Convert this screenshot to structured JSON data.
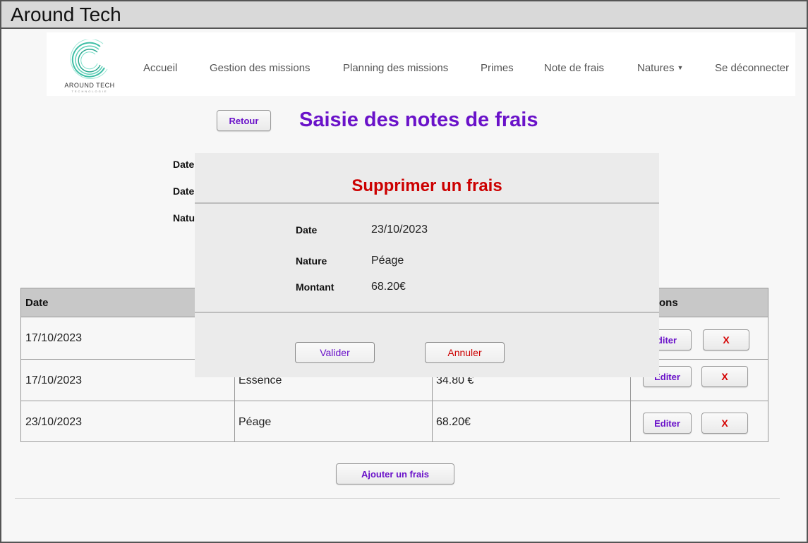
{
  "window": {
    "title": "Around Tech"
  },
  "logo": {
    "name": "AROUND TECH",
    "sub": "TECHNOLOGIE"
  },
  "nav": {
    "items": [
      "Accueil",
      "Gestion des missions",
      "Planning des missions",
      "Primes",
      "Note de frais"
    ],
    "dropdown": "Natures",
    "logout": "Se déconnecter"
  },
  "page": {
    "back_button": "Retour",
    "title": "Saisie des notes de frais",
    "form_labels": [
      "Date",
      "Date",
      "Natu"
    ],
    "add_button": "Ajouter un frais"
  },
  "table": {
    "headers": {
      "date": "Date",
      "actions": "ons"
    },
    "rows": [
      {
        "date": "17/10/2023",
        "nature": "",
        "montant": "",
        "edit": "diter",
        "delete": "X"
      },
      {
        "date": "17/10/2023",
        "nature": "Essence",
        "montant": "34.80 €",
        "edit": "Editer",
        "delete": "X"
      },
      {
        "date": "23/10/2023",
        "nature": "Péage",
        "montant": "68.20€",
        "edit": "Editer",
        "delete": "X"
      }
    ]
  },
  "modal": {
    "title": "Supprimer un frais",
    "fields": [
      {
        "label": "Date",
        "value": "23/10/2023"
      },
      {
        "label": "Nature",
        "value": "Péage"
      },
      {
        "label": "Montant",
        "value": "68.20€"
      }
    ],
    "confirm": "Valider",
    "cancel": "Annuler"
  },
  "colors": {
    "accent_purple": "#6a12c9",
    "danger_red": "#cc0000",
    "logo_teal": "#3fbfa6"
  }
}
